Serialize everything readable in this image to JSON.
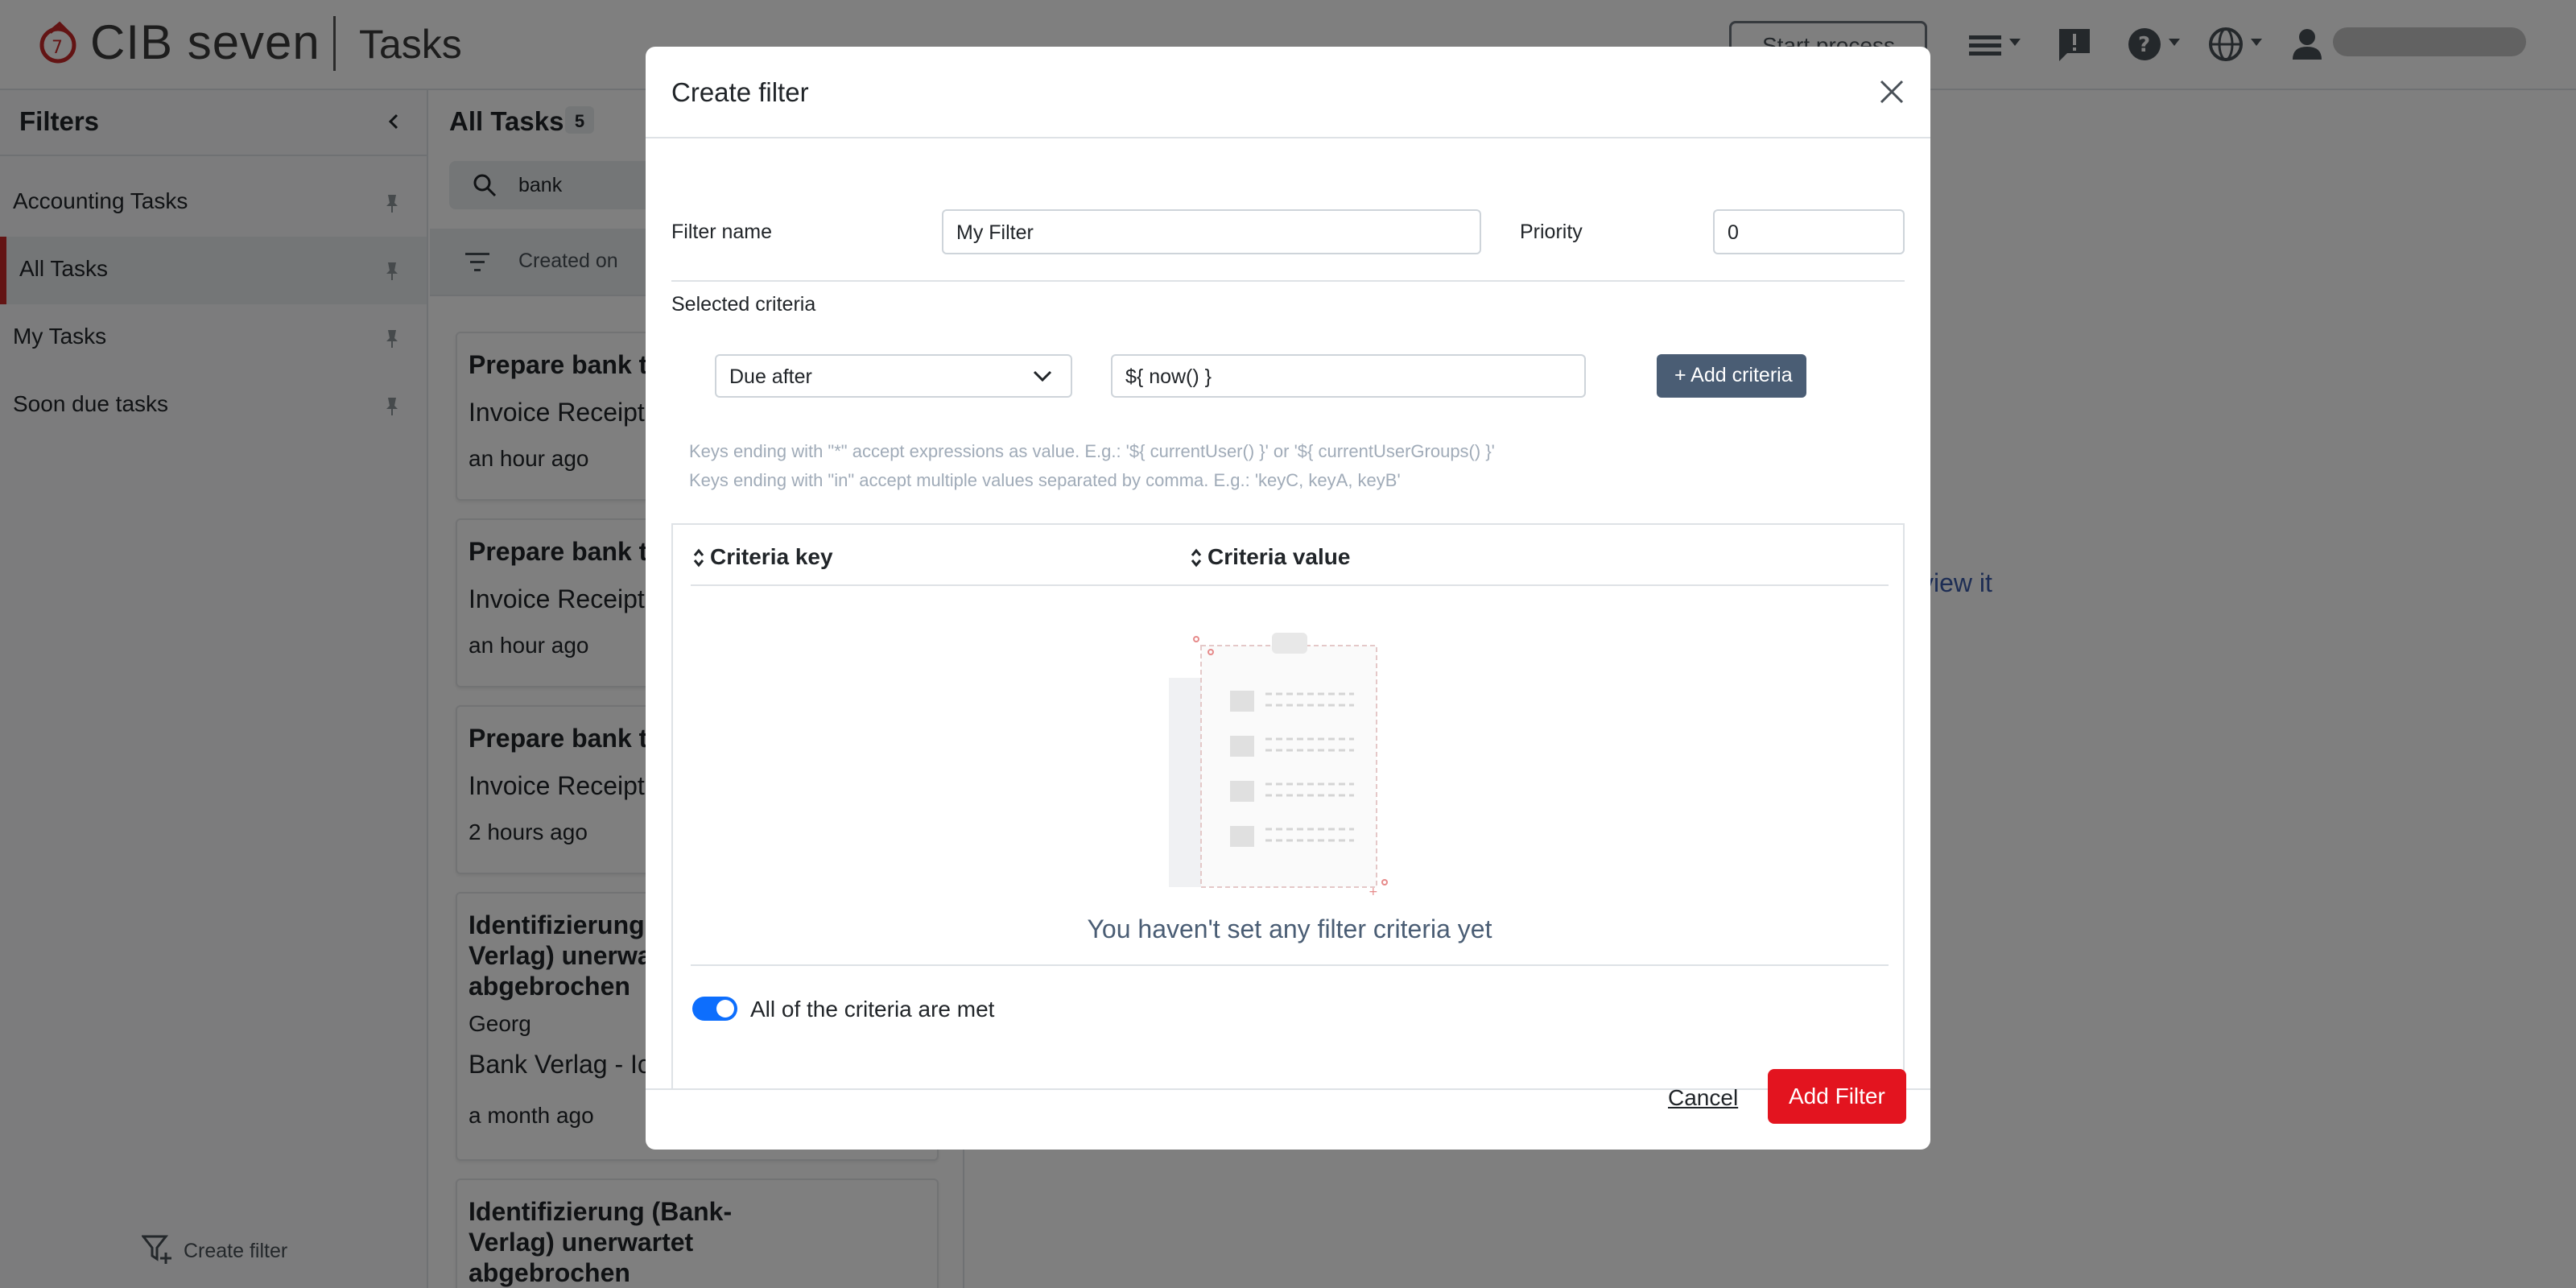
{
  "header": {
    "brand": "CIB seven",
    "app_name": "Tasks",
    "start_process": "Start process"
  },
  "sidebar": {
    "title": "Filters",
    "items": [
      {
        "label": "Accounting Tasks"
      },
      {
        "label": "All Tasks"
      },
      {
        "label": "My Tasks"
      },
      {
        "label": "Soon due tasks"
      }
    ],
    "create_filter": "Create filter"
  },
  "tasklist": {
    "title": "All Tasks",
    "count": "5",
    "search_value": "bank",
    "sort_label": "Created on",
    "tasks": [
      {
        "title": "Prepare bank t",
        "subtitle": "Invoice Receipt",
        "age": "an hour ago"
      },
      {
        "title": "Prepare bank t",
        "subtitle": "Invoice Receipt",
        "age": "an hour ago"
      },
      {
        "title": "Prepare bank t",
        "subtitle": "Invoice Receipt",
        "age": "2 hours ago"
      },
      {
        "title_l1": "Identifizierung",
        "title_l2": "Verlag) unerwa",
        "title_l3": "abgebrochen",
        "assignee": "Georg",
        "subtitle": "Bank Verlag - Ic",
        "age": "a month ago"
      },
      {
        "title_l1": "Identifizierung (Bank-",
        "title_l2": "Verlag) unerwartet",
        "title_l3": "abgebrochen"
      }
    ]
  },
  "main": {
    "hint": "view it"
  },
  "modal": {
    "title": "Create filter",
    "filter_name_label": "Filter name",
    "filter_name_value": "My Filter",
    "priority_label": "Priority",
    "priority_value": "0",
    "selected_criteria_label": "Selected criteria",
    "criteria_select_value": "Due after",
    "criteria_value_input": "${ now() }",
    "add_criteria": "+ Add criteria",
    "hint_line1": "Keys ending with \"*\" accept expressions as value. E.g.: '${ currentUser() }' or '${ currentUserGroups() }'",
    "hint_line2": "Keys ending with \"in\" accept multiple values separated by comma. E.g.: 'keyC, keyA, keyB'",
    "col_key": "Criteria key",
    "col_value": "Criteria value",
    "empty_text": "You haven't set any filter criteria yet",
    "toggle_label": "All of the criteria are met",
    "cancel": "Cancel",
    "submit": "Add Filter"
  },
  "colors": {
    "brand_red": "#e3141f",
    "secondary": "#4a5d74",
    "toggle_on": "#0d6efd"
  }
}
